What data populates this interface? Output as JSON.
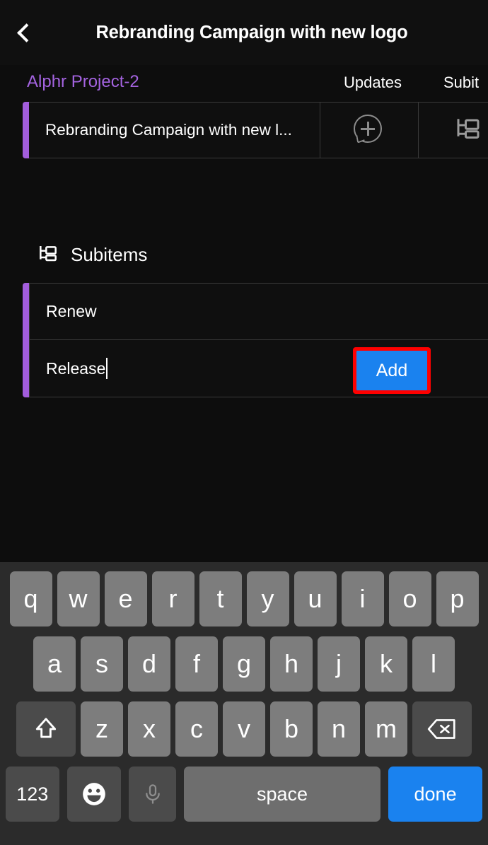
{
  "header": {
    "back_icon": "chevron-left-icon",
    "title": "Rebranding Campaign with new logo"
  },
  "board": {
    "group_name": "Alphr Project-2",
    "columns": [
      {
        "label": "Updates",
        "icon": "chat-bubble-plus-icon"
      },
      {
        "label": "Subit",
        "icon": "subitems-tree-icon"
      }
    ],
    "row": {
      "title": "Rebranding Campaign with new l...",
      "accent_color": "#a25ddc"
    }
  },
  "subitems": {
    "section_icon": "subitems-tree-icon",
    "section_title": "Subitems",
    "items": [
      {
        "name": "Renew"
      },
      {
        "name": "Release"
      }
    ],
    "add_button_label": "Add",
    "add_button_color": "#1a82ef",
    "highlight_color": "#ff0000"
  },
  "keyboard": {
    "row1": [
      "q",
      "w",
      "e",
      "r",
      "t",
      "y",
      "u",
      "i",
      "o",
      "p"
    ],
    "row2": [
      "a",
      "s",
      "d",
      "f",
      "g",
      "h",
      "j",
      "k",
      "l"
    ],
    "row3": [
      "z",
      "x",
      "c",
      "v",
      "b",
      "n",
      "m"
    ],
    "shift_icon": "shift-arrow-icon",
    "backspace_icon": "backspace-icon",
    "numbers_key": "123",
    "emoji_icon": "emoji-smiley-icon",
    "mic_icon": "microphone-icon",
    "space_key": "space",
    "done_key": "done"
  },
  "colors": {
    "background": "#0d0d0d",
    "accent_purple": "#a463e0",
    "blue": "#1a82ef",
    "keyboard_bg": "#2b2b2b"
  }
}
